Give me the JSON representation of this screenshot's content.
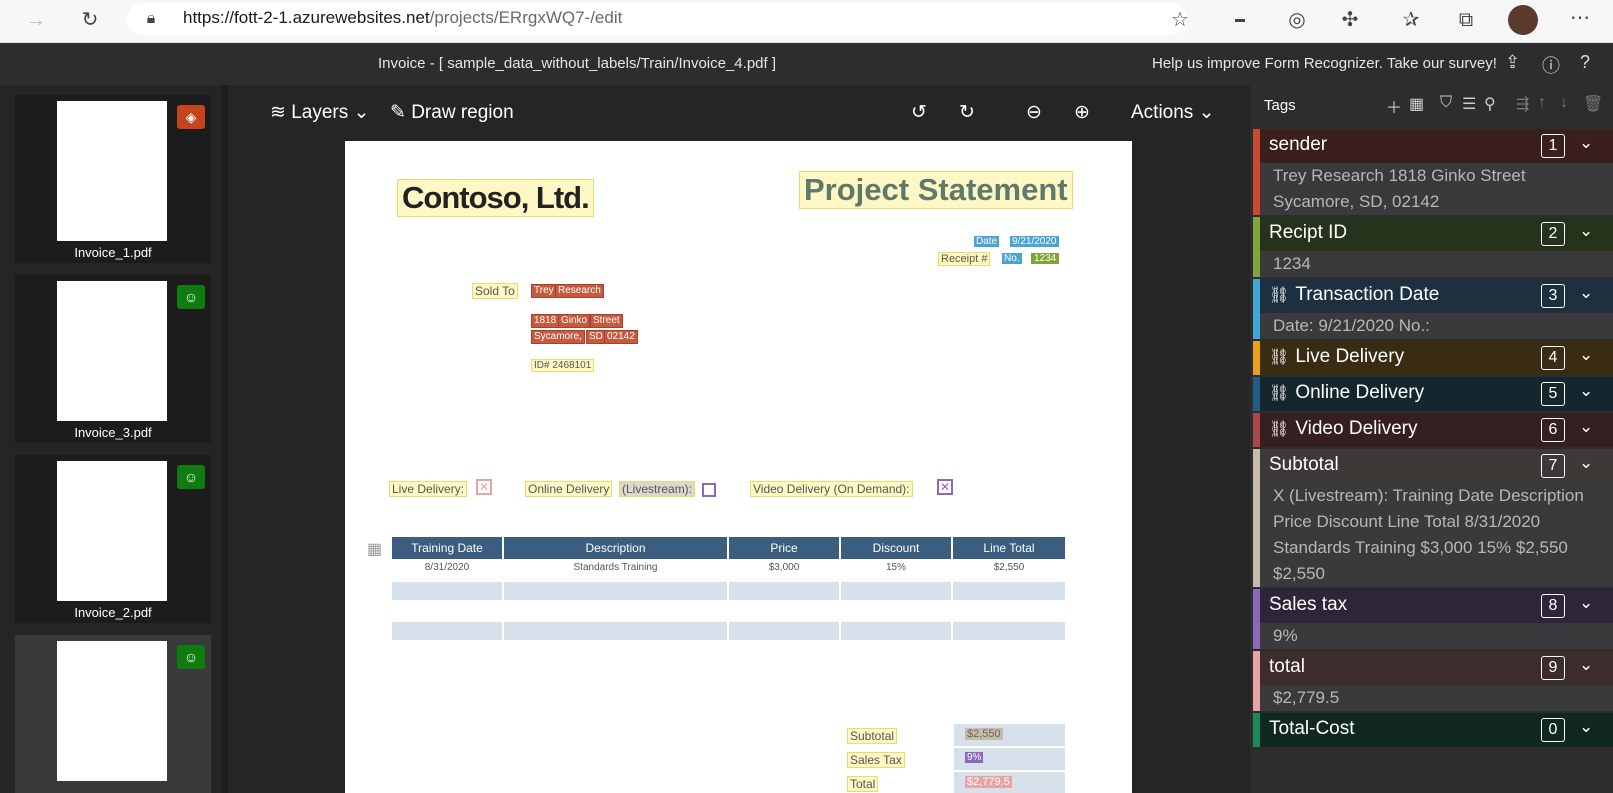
{
  "browser": {
    "url_host": "https://fott-2-1.azurewebsites.net",
    "url_path": "/projects/ERrgxWQ7-/edit"
  },
  "titlebar": {
    "document_title": "Invoice - [ sample_data_without_labels/Train/Invoice_4.pdf ]",
    "survey": "Help us improve Form Recognizer. Take our survey!"
  },
  "thumbnails": [
    {
      "name": "Invoice_1.pdf",
      "badge": "tag-icon",
      "badge_color": "#c4451c"
    },
    {
      "name": "Invoice_3.pdf",
      "badge": "robot-icon",
      "badge_color": "#107c10"
    },
    {
      "name": "Invoice_2.pdf",
      "badge": "robot-icon",
      "badge_color": "#107c10"
    },
    {
      "name": "",
      "badge": "robot-icon",
      "badge_color": "#107c10"
    }
  ],
  "toolbar": {
    "layers": "Layers",
    "draw_region": "Draw region",
    "actions": "Actions"
  },
  "document": {
    "company": "Contoso, Ltd.",
    "heading": "Project Statement",
    "date_label": "Date",
    "date_value": "9/21/2020",
    "receipt_label": "Receipt #",
    "no_label": "No.",
    "no_value": "1234",
    "sold_to": "Sold To",
    "name1": "Trey",
    "name2": "Research",
    "addr1": "1818",
    "addr2": "Ginko",
    "addr3": "Street",
    "city": "Sycamore,",
    "state": "SD,",
    "zip": "02142",
    "id_line": "ID# 2468101",
    "live_delivery": "Live Delivery:",
    "online_delivery": "Online Delivery",
    "livestream": "(Livestream):",
    "video_delivery": "Video Delivery (On Demand):",
    "columns": [
      "Training Date",
      "Description",
      "Price",
      "Discount",
      "Line Total"
    ],
    "row": [
      "8/31/2020",
      "Standards Training",
      "$3,000",
      "15%",
      "$2,550"
    ],
    "subtotal_label": "Subtotal",
    "subtotal_value": "$2,550",
    "tax_label": "Sales Tax",
    "tax_value": "9%",
    "total_label": "Total",
    "total_value": "$2,779.5"
  },
  "tags_panel": {
    "title": "Tags",
    "tags": [
      {
        "name": "sender",
        "num": "1",
        "color": "#c94a2f",
        "bg": "#3a1f1c",
        "linked": false,
        "value": [
          "Trey Research 1818 Ginko Street",
          "Sycamore, SD, 02142"
        ]
      },
      {
        "name": "Recipt ID",
        "num": "2",
        "color": "#7fa43a",
        "bg": "#26321c",
        "linked": false,
        "value": [
          "1234"
        ]
      },
      {
        "name": "Transaction Date",
        "num": "3",
        "color": "#3fa6d8",
        "bg": "#1c3040",
        "linked": true,
        "value": [
          "Date: 9/21/2020 No.:"
        ]
      },
      {
        "name": "Live Delivery",
        "num": "4",
        "color": "#e8a21c",
        "bg": "#3a2c12",
        "linked": true,
        "value": []
      },
      {
        "name": "Online Delivery",
        "num": "5",
        "color": "#1f5f85",
        "bg": "#16262f",
        "linked": true,
        "value": []
      },
      {
        "name": "Video Delivery",
        "num": "6",
        "color": "#a84848",
        "bg": "#361f20",
        "linked": true,
        "value": []
      },
      {
        "name": "Subtotal",
        "num": "7",
        "color": "#c7bca8",
        "bg": "#3d3936",
        "linked": false,
        "value": [
          "X (Livestream): Training Date Description",
          "Price Discount Line Total 8/31/2020",
          "Standards Training $3,000 15% $2,550",
          "$2,550"
        ]
      },
      {
        "name": "Sales tax",
        "num": "8",
        "color": "#8a6ab8",
        "bg": "#2e2638",
        "linked": false,
        "value": [
          "9%"
        ]
      },
      {
        "name": "total",
        "num": "9",
        "color": "#e8a3a3",
        "bg": "#3d2c2c",
        "linked": false,
        "value": [
          "$2,779.5"
        ]
      },
      {
        "name": "Total-Cost",
        "num": "0",
        "color": "#1a8a5a",
        "bg": "#11281e",
        "linked": false,
        "value": []
      }
    ]
  }
}
